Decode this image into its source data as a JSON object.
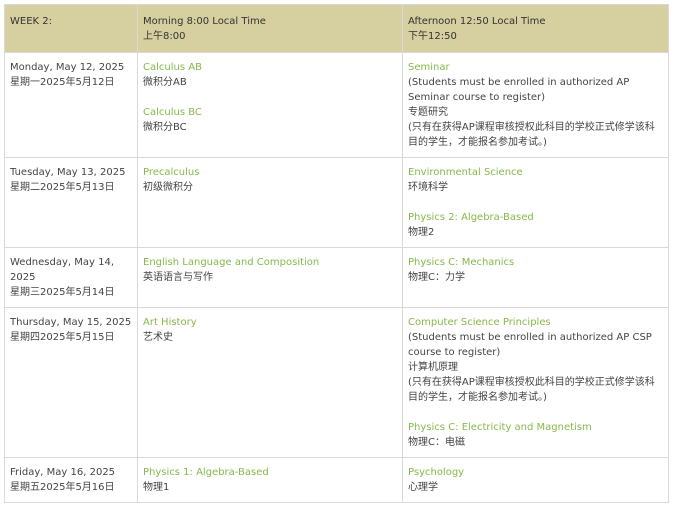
{
  "header": {
    "week": "WEEK 2:",
    "morning_en": "Morning 8:00 Local Time",
    "morning_zh": "上午8:00",
    "afternoon_en": "Afternoon 12:50 Local Time",
    "afternoon_zh": "下午12:50"
  },
  "colors": {
    "header_bg": "#d6cf9f",
    "link": "#87b84a",
    "border": "#d9d9d9"
  },
  "rows": [
    {
      "date_en": "Monday, May 12, 2025",
      "date_zh": "星期一2025年5月12日",
      "morning": [
        {
          "en": "Calculus AB",
          "zh": "微积分AB"
        },
        {
          "en": "Calculus BC",
          "zh": "微积分BC"
        }
      ],
      "afternoon": [
        {
          "en": "Seminar",
          "note": "(Students must be enrolled in authorized AP Seminar course to register)",
          "zh": "专题研究",
          "note_zh": "(只有在获得AP课程审核授权此科目的学校正式修学该科目的学生，才能报名参加考试。)"
        }
      ]
    },
    {
      "date_en": "Tuesday, May 13, 2025",
      "date_zh": "星期二2025年5月13日",
      "morning": [
        {
          "en": "Precalculus",
          "zh": "初级微积分"
        }
      ],
      "afternoon": [
        {
          "en": "Environmental Science",
          "zh": "环境科学"
        },
        {
          "en": "Physics 2: Algebra-Based",
          "zh": "物理2"
        }
      ]
    },
    {
      "date_en": "Wednesday, May 14, 2025",
      "date_zh": "星期三2025年5月14日",
      "morning": [
        {
          "en": "English Language and Composition",
          "zh": "英语语言与写作"
        }
      ],
      "afternoon": [
        {
          "en": "Physics C: Mechanics",
          "zh": "物理C：力学"
        }
      ]
    },
    {
      "date_en": "Thursday, May 15, 2025",
      "date_zh": "星期四2025年5月15日",
      "morning": [
        {
          "en": "Art History",
          "zh": "艺术史"
        }
      ],
      "afternoon": [
        {
          "en": "Computer Science Principles",
          "note": "(Students must be enrolled in authorized AP CSP course to register)",
          "zh": "计算机原理",
          "note_zh": "(只有在获得AP课程审核授权此科目的学校正式修学该科目的学生，才能报名参加考试。)"
        },
        {
          "en": "Physics C: Electricity and Magnetism",
          "zh": "物理C：电磁"
        }
      ]
    },
    {
      "date_en": "Friday, May 16, 2025",
      "date_zh": "星期五2025年5月16日",
      "morning": [
        {
          "en": "Physics 1: Algebra-Based",
          "zh": "物理1"
        }
      ],
      "afternoon": [
        {
          "en": "Psychology",
          "zh": "心理学"
        }
      ]
    }
  ]
}
